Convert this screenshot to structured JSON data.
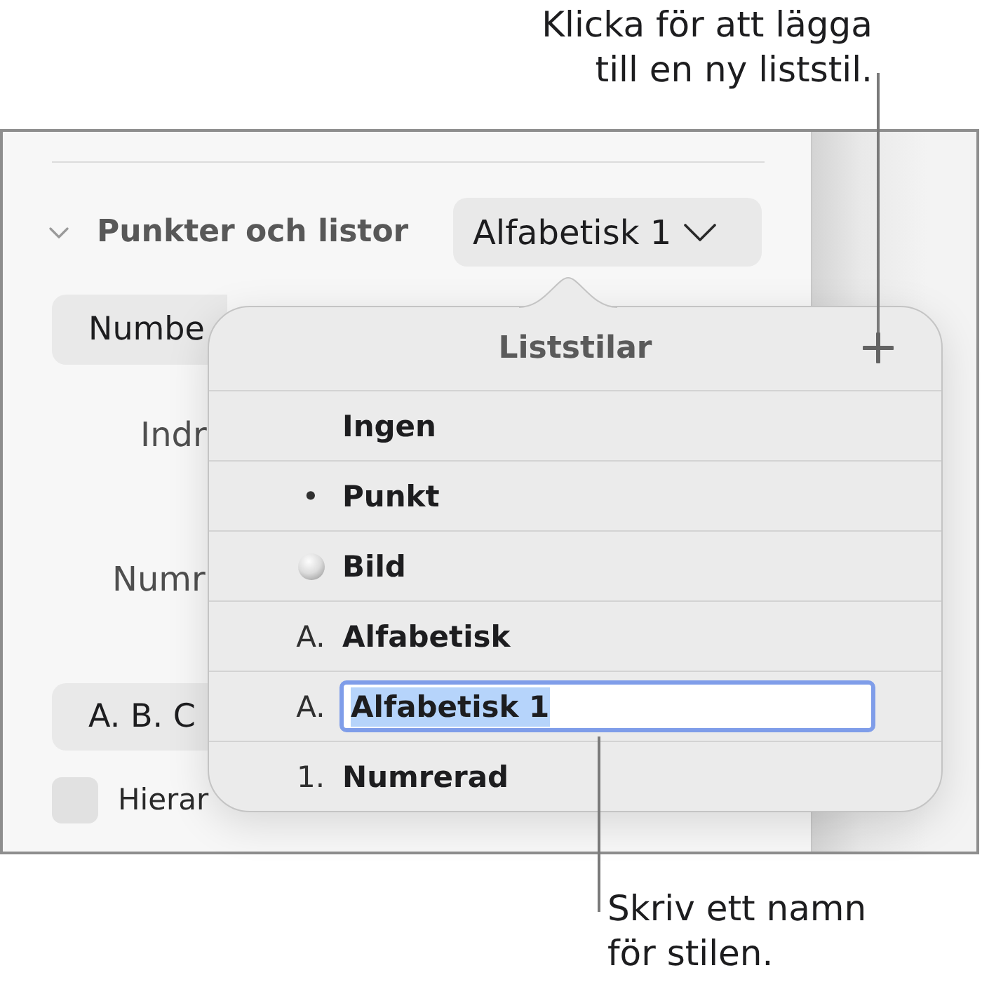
{
  "annotations": [
    {
      "kind": "top",
      "text": "Klicka för att lägga till en ny liststil."
    },
    {
      "kind": "bottom",
      "text": "Skriv ett namn för stilen."
    }
  ],
  "sidebar": {
    "section": {
      "title": "Punkter och listor",
      "expanded": true,
      "style_button": "Alfabetisk 1"
    },
    "rows": [
      {
        "kind": "popup",
        "text": "Numbe"
      },
      {
        "kind": "label",
        "text": "Indr"
      },
      {
        "kind": "label",
        "text": "Numr"
      },
      {
        "kind": "popup",
        "text": "A. B. C"
      },
      {
        "kind": "checkbox",
        "label": "Hierar",
        "checked": false
      }
    ]
  },
  "popover": {
    "title": "Liststilar",
    "styles": [
      {
        "kind": "none",
        "name": "Ingen",
        "editing": false
      },
      {
        "kind": "text",
        "marker": "•",
        "name": "Punkt",
        "editing": false
      },
      {
        "kind": "image",
        "name": "Bild",
        "editing": false
      },
      {
        "kind": "text",
        "marker": "A.",
        "name": "Alfabetisk",
        "editing": false
      },
      {
        "kind": "text",
        "marker": "A.",
        "name": "Alfabetisk 1",
        "editing": true
      },
      {
        "kind": "text",
        "marker": "1.",
        "name": "Numrerad",
        "editing": false
      }
    ]
  }
}
